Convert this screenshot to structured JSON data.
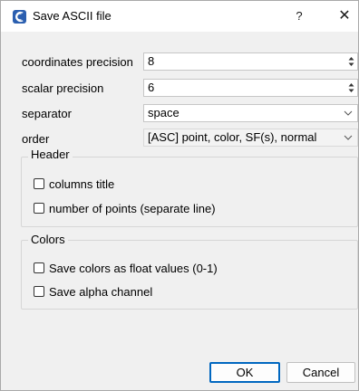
{
  "window": {
    "title": "Save ASCII file",
    "help_label": "?",
    "close_label": "✕",
    "app_icon": "cloudcompare-logo-icon",
    "accent_color": "#0067c0"
  },
  "form": {
    "coordinates_precision": {
      "label": "coordinates precision",
      "value": "8"
    },
    "scalar_precision": {
      "label": "scalar precision",
      "value": "6"
    },
    "separator": {
      "label": "separator",
      "value": "space"
    },
    "order": {
      "label": "order",
      "value": "[ASC] point, color, SF(s), normal"
    }
  },
  "header_group": {
    "title": "Header",
    "options": [
      {
        "label": "columns title",
        "checked": false
      },
      {
        "label": "number of points (separate line)",
        "checked": false
      }
    ]
  },
  "colors_group": {
    "title": "Colors",
    "options": [
      {
        "label": "Save colors as float values (0-1)",
        "checked": false
      },
      {
        "label": "Save alpha channel",
        "checked": false
      }
    ]
  },
  "buttons": {
    "ok": "OK",
    "cancel": "Cancel"
  }
}
